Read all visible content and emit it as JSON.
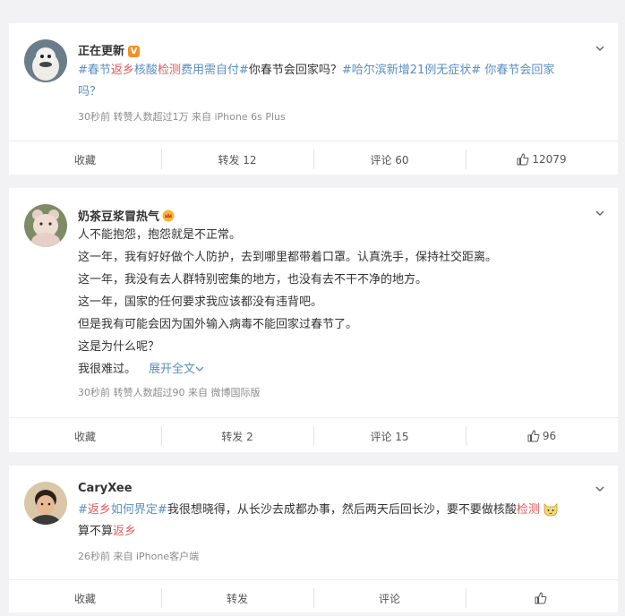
{
  "posts": [
    {
      "username": "正在更新",
      "verified_badge": "V",
      "content": {
        "t1": "#春节",
        "t1h": "返乡",
        "t2": "核酸",
        "t2h": "检测",
        "t3": "费用需自付#",
        "p1": "你春节会回家吗？",
        "t4": "#哈尔滨新增21例无症状#",
        "t5": " 你春节会回家",
        "t6": "吗？"
      },
      "meta": "30秒前  转赞人数超过1万   来自 iPhone 6s Plus",
      "actions": {
        "collect": "收藏",
        "repost": "转发 12",
        "comment": "评论 60",
        "like": "12079"
      }
    },
    {
      "username": "奶茶豆浆冒热气",
      "lines": [
        "人不能抱怨，抱怨就是不正常。",
        "这一年，我有好好做个人防护，去到哪里都带着口罩。认真洗手，保持社交距离。",
        "这一年，我没有去人群特别密集的地方，也没有去不干不净的地方。",
        "这一年，国家的任何要求我应该都没有违背吧。",
        "但是我有可能会因为国外输入病毒不能回家过春节了。",
        "这是为什么呢？",
        "我很难过。"
      ],
      "expand": "展开全文",
      "meta": "30秒前  转赞人数超过90   来自 微博国际版",
      "actions": {
        "collect": "收藏",
        "repost": "转发 2",
        "comment": "评论 15",
        "like": "96"
      }
    },
    {
      "username": "CaryXee",
      "content": {
        "t1": "#",
        "t1h": "返乡",
        "t2": "如何界定#",
        "p1": "我很想晓得，从长沙去成都办事，然后两天后回长沙，要不要做核酸",
        "p1h": "检测",
        "p2": "算不算",
        "p2h": "返乡"
      },
      "meta": "26秒前  来自 iPhone客户端",
      "actions": {
        "collect": "收藏",
        "repost": "转发",
        "comment": "评论",
        "like": ""
      }
    }
  ],
  "colors": {
    "topic": "#5a8ec3",
    "highlight": "#e0595b",
    "badge": "#f0912a"
  }
}
